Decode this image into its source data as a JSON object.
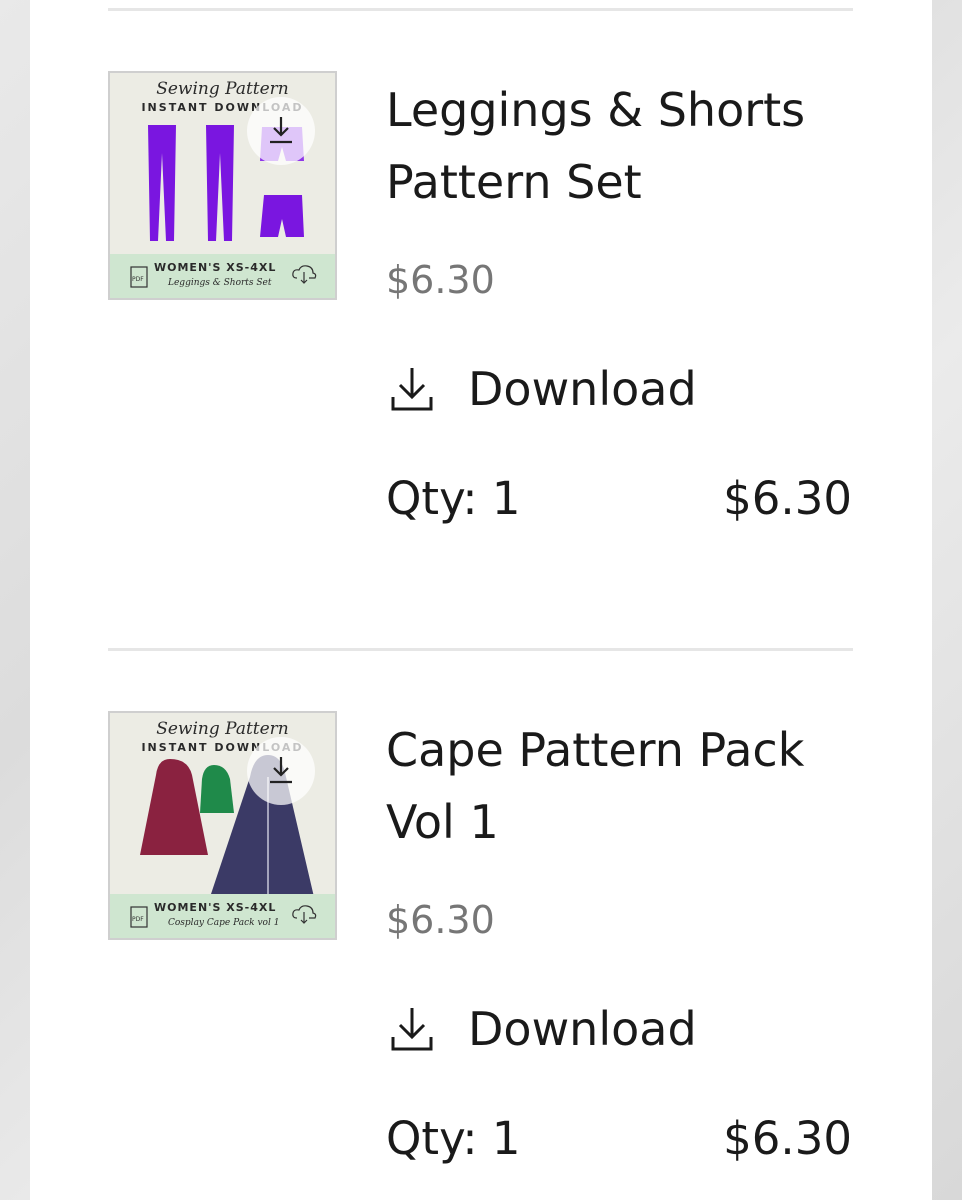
{
  "items": [
    {
      "name": "Leggings & Shorts Pattern Set",
      "price": "$6.30",
      "download_label": "Download",
      "qty_label": "Qty: 1",
      "line_total": "$6.30",
      "thumbnail": {
        "title": "Sewing Pattern",
        "subtitle": "INSTANT DOWNLOAD",
        "sizes": "WOMEN'S XS-4XL",
        "caption": "Leggings & Shorts Set",
        "garment_color": "#7a16e0"
      }
    },
    {
      "name": "Cape Pattern Pack Vol 1",
      "price": "$6.30",
      "download_label": "Download",
      "qty_label": "Qty: 1",
      "line_total": "$6.30",
      "thumbnail": {
        "title": "Sewing Pattern",
        "subtitle": "INSTANT DOWNLOAD",
        "sizes": "WOMEN'S XS-4XL",
        "caption": "Cosplay Cape Pack vol 1",
        "garment_colors": [
          "#8a2240",
          "#1f8a4a",
          "#3b3a66"
        ]
      }
    }
  ],
  "icons": {
    "download": "download-icon",
    "pdf": "pdf-icon",
    "cloud": "cloud-download-icon"
  },
  "colors": {
    "price_gray": "#767676",
    "text": "#1a1a1a",
    "thumb_band": "#cfe6d0"
  }
}
